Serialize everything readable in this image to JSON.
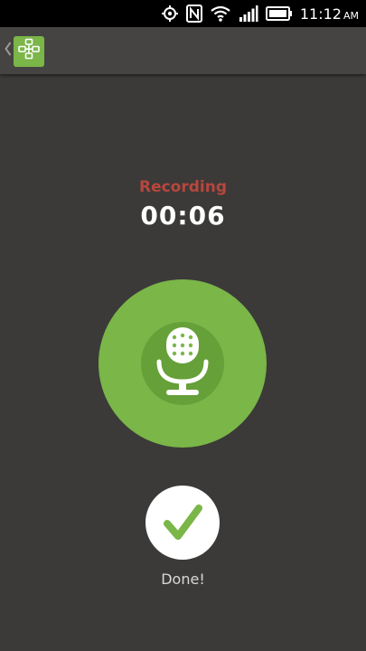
{
  "status_bar": {
    "time": "11:12",
    "ampm": "AM",
    "icons": [
      "gps-icon",
      "nfc-icon",
      "wifi-icon",
      "signal-icon",
      "battery-icon"
    ]
  },
  "app_bar": {
    "back_icon": "chevron-left-icon",
    "logo_icon": "family-tree-icon"
  },
  "recording": {
    "status_label": "Recording",
    "elapsed": "00:06"
  },
  "mic_button": {
    "icon": "microphone-icon"
  },
  "done_button": {
    "icon": "checkmark-icon",
    "label": "Done!"
  },
  "colors": {
    "background": "#3b3a38",
    "app_bar": "#454442",
    "accent_green": "#7ab648",
    "accent_green_dark": "#65a038",
    "recording_red": "#b8463d",
    "text_white": "#ffffff"
  }
}
